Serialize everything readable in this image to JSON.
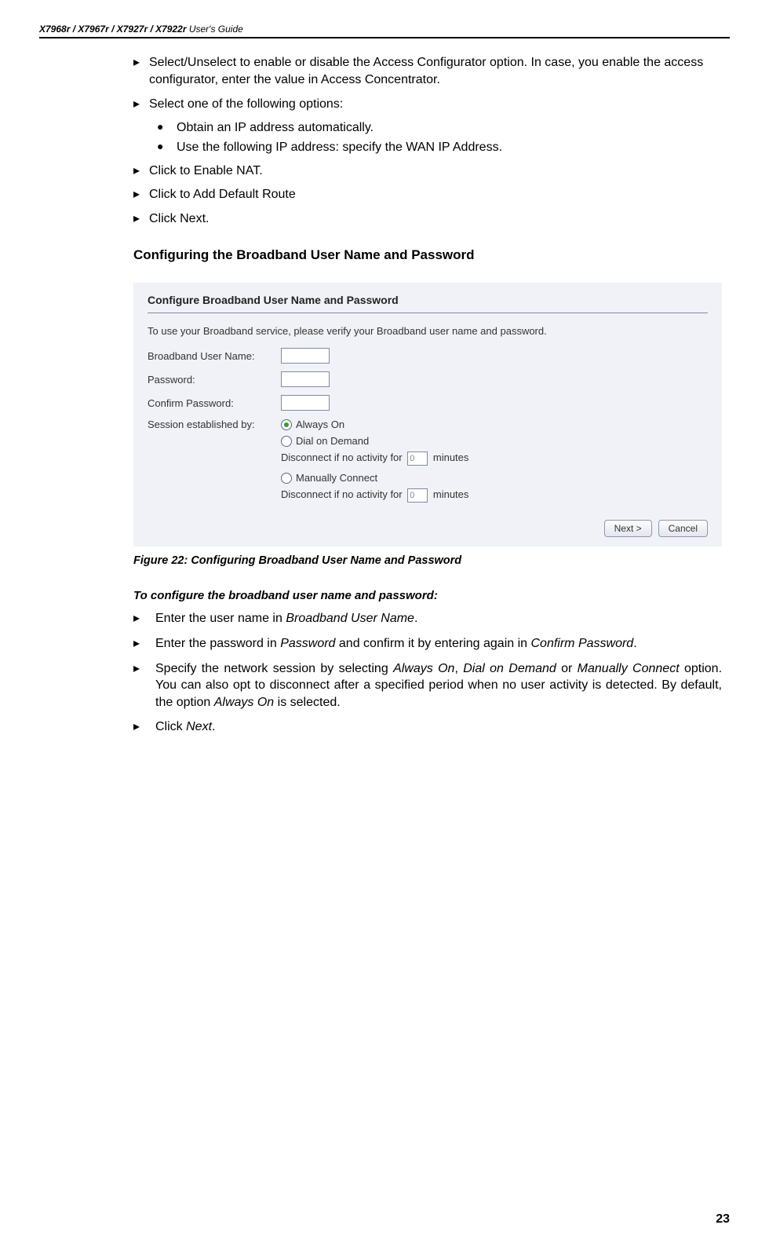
{
  "header": {
    "models": "X7968r / X7967r / X7927r / X7922r",
    "suffix": " User's Guide"
  },
  "top_bullets": [
    "Select/Unselect to enable or disable the Access Configurator option. In case, you enable the access configurator, enter the value in Access Concentrator.",
    "Select one of the following options:"
  ],
  "sub_bullets": [
    "Obtain an IP address automatically.",
    "Use the following IP address: specify the WAN IP Address."
  ],
  "top_bullets_after": [
    "Click to Enable NAT.",
    "Click to Add Default Route",
    "Click Next."
  ],
  "section_heading": "Configuring the Broadband User Name and Password",
  "screenshot": {
    "title": "Configure Broadband User Name and Password",
    "intro": "To use your Broadband service, please verify your Broadband user name and password.",
    "labels": {
      "user": "Broadband User Name:",
      "password": "Password:",
      "confirm": "Confirm Password:",
      "session": "Session established by:"
    },
    "radios": {
      "always": "Always On",
      "dial": "Dial on Demand",
      "manual": "Manually Connect"
    },
    "disconnect_prefix": "Disconnect if no activity for",
    "disconnect_value": "0",
    "disconnect_suffix": "minutes",
    "buttons": {
      "next": "Next >",
      "cancel": "Cancel"
    }
  },
  "figure_caption": "Figure 22: Configuring Broadband User Name and Password",
  "procedure_heading": "To configure the broadband user name and password:",
  "procedure": [
    {
      "pre": "Enter the user name in ",
      "em": "Broadband User Name",
      "post": "."
    },
    {
      "pre": "Enter the password in ",
      "em": "Password",
      "mid": " and confirm it by entering again in ",
      "em2": "Confirm Password",
      "post": "."
    },
    {
      "pre": "Specify the network session by selecting ",
      "em": "Always On",
      "mid": ", ",
      "em2": "Dial on Demand",
      "mid2": " or ",
      "em3": "Manually Connect",
      "post": " option. You can also opt to disconnect after a specified period when no user activity is detected.   By default, the option ",
      "em4": "Always On",
      "post2": " is selected."
    },
    {
      "pre": "Click ",
      "em": "Next",
      "post": "."
    }
  ],
  "page_number": "23"
}
